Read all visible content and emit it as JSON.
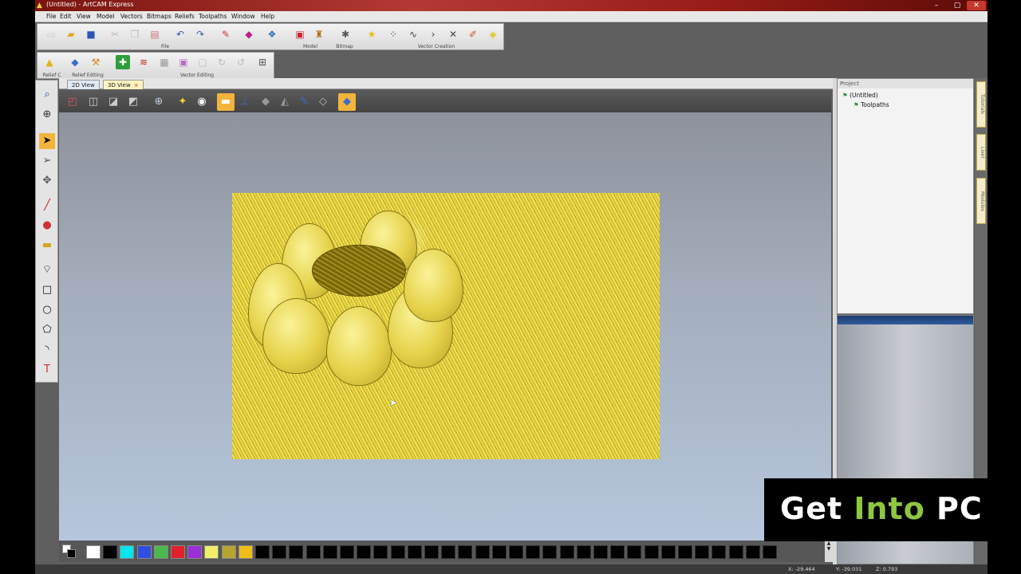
{
  "window": {
    "title": "(Untitled) - ArtCAM Express",
    "colors": {
      "title_bg": "#a52a22",
      "close_bg": "#c5382d"
    }
  },
  "menu": [
    "File",
    "Edit",
    "View",
    "Model",
    "Vectors",
    "Bitmaps",
    "Reliefs",
    "Toolpaths",
    "Window",
    "Help"
  ],
  "toolbars": {
    "file_label": "File",
    "model_label": "Model",
    "bitmap_label": "Bitmap",
    "vector_creation_label": "Vector Creation",
    "relief_c_label": "Relief C",
    "relief_editing_label": "Relief Editing",
    "vector_editing_label": "Vector Editing"
  },
  "view_tabs": [
    {
      "label": "2D View"
    },
    {
      "label": "3D View",
      "close": "×"
    }
  ],
  "project_panel": {
    "header": "Project",
    "items": [
      "(Untitled)",
      "Toolpaths"
    ]
  },
  "right_tabs": [
    "Tutorials",
    "Live!",
    "Modules"
  ],
  "palette": {
    "colors": [
      "#ffffff",
      "#000000",
      "#00e5ee",
      "#2f4fe0",
      "#4cb84c",
      "#e0202a",
      "#9b30d9",
      "#f3ee6a",
      "#b8a530",
      "#f0bd16",
      "#000000",
      "#000000",
      "#000000",
      "#000000",
      "#000000",
      "#000000",
      "#000000",
      "#000000",
      "#000000",
      "#000000",
      "#000000",
      "#000000",
      "#000000",
      "#000000",
      "#000000",
      "#000000",
      "#000000",
      "#000000",
      "#000000",
      "#000000",
      "#000000",
      "#000000",
      "#000000",
      "#000000",
      "#000000",
      "#000000",
      "#000000",
      "#000000",
      "#000000",
      "#000000",
      "#000000"
    ]
  },
  "status": {
    "x": "X: -29.464",
    "y": "Y: -39.031",
    "z": "Z: 0.793"
  },
  "watermark": {
    "part1": "Get ",
    "part2": "Into",
    "part3": " PC",
    "colors": {
      "white": "#ffffff",
      "green": "#8dc63f"
    }
  },
  "icons": {
    "new": "new-file-icon",
    "open": "open-folder-icon",
    "save": "save-icon",
    "cut": "cut-icon",
    "copy": "copy-icon",
    "paste": "paste-icon",
    "undo": "undo-icon",
    "redo": "redo-icon"
  }
}
